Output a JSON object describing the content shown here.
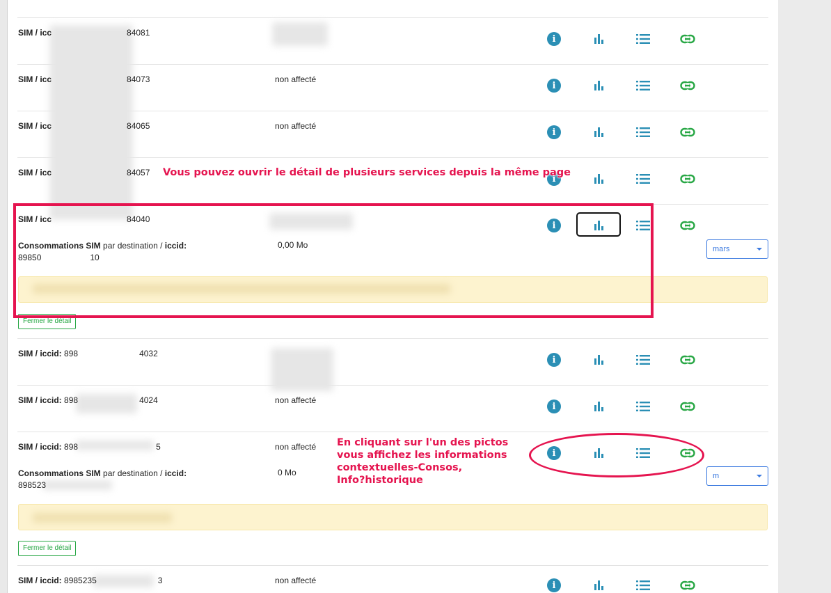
{
  "rows": [
    {
      "label_prefix": "SIM / icc",
      "label_suffix": "84081",
      "status": ""
    },
    {
      "label_prefix": "SIM / icc",
      "label_suffix": "84073",
      "status": "non affecté"
    },
    {
      "label_prefix": "SIM / icc",
      "label_suffix": "84065",
      "status": "non affecté"
    },
    {
      "label_prefix": "SIM / icc",
      "label_suffix": "84057",
      "status": ""
    },
    {
      "label_prefix": "SIM / icc",
      "label_suffix": "84040",
      "status": ""
    },
    {
      "label_prefix": "SIM / iccid:",
      "label_suffix": "898",
      "label_tail": "4032",
      "status": ""
    },
    {
      "label_prefix": "SIM / iccid:",
      "label_suffix": "898",
      "label_tail": "4024",
      "status": "non affecté"
    },
    {
      "label_prefix": "SIM / iccid:",
      "label_suffix": "898",
      "label_tail": "5",
      "status": "non affecté"
    },
    {
      "label_prefix": "SIM / iccid:",
      "label_suffix": "8985235",
      "label_tail": "3",
      "status": "non affecté"
    }
  ],
  "details": [
    {
      "title_bold": "Consommations SIM",
      "title_rest": " par destination / ",
      "title_bold2": "iccid:",
      "iccid_value": "89850",
      "iccid_tail": "10",
      "consumption": "0,00 Mo",
      "month": "mars",
      "close_label": "Fermer le détail"
    },
    {
      "title_bold": "Consommations SIM",
      "title_rest": " par destination / ",
      "title_bold2": "iccid:",
      "iccid_value": "898523",
      "iccid_tail": "",
      "consumption": "0 Mo",
      "month": "m",
      "close_label": "Fermer le détail"
    }
  ],
  "annotations": {
    "top": "Vous pouvez ouvrir le détail de plusieurs services depuis la même page",
    "bottom_lines": [
      "En cliquant sur l'un des pictos",
      "vous affichez les informations",
      "contextuelles-Consos,",
      "Info?historique"
    ]
  },
  "icons": [
    "info-icon",
    "bar-chart-icon",
    "list-icon",
    "link-icon"
  ],
  "colors": {
    "icon": "#2b8fb5",
    "link_icon": "#28a745",
    "annotation": "#e5144f",
    "alert_bg": "#fdf3cf",
    "select": "#3d7be0"
  }
}
